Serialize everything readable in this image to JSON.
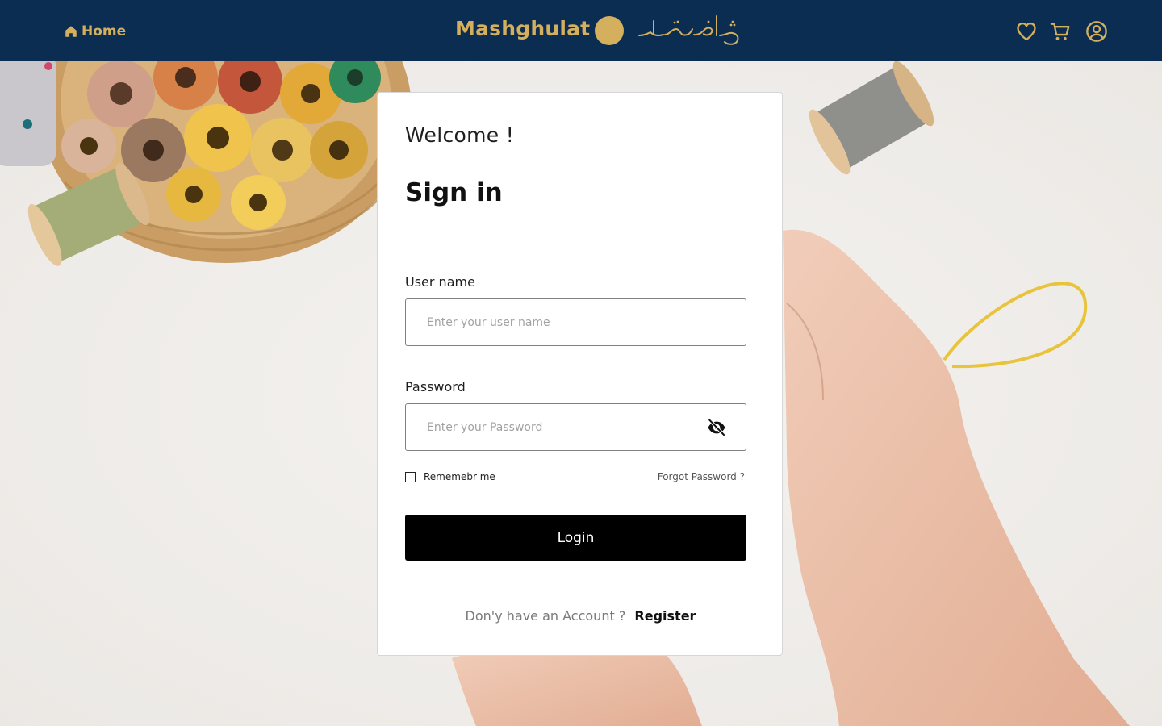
{
  "header": {
    "home_label": "Home",
    "brand_latin": "Mashghulat",
    "brand_arabic": "مشغولات",
    "icons": [
      "home-icon",
      "heart-icon",
      "cart-icon",
      "user-circle-icon"
    ],
    "colors": {
      "navy": "#0b2d52",
      "gold": "#d4b05e"
    }
  },
  "login": {
    "welcome": "Welcome !",
    "title": "Sign in",
    "username_label": "User name",
    "username_placeholder": "Enter your user name",
    "password_label": "Password",
    "password_placeholder": "Enter your Password",
    "remember_label": "Rememebr me",
    "forgot_label": "Forgot Password ?",
    "login_label": "Login",
    "no_account": "Don'y have an Account ?",
    "register_label": "Register"
  }
}
